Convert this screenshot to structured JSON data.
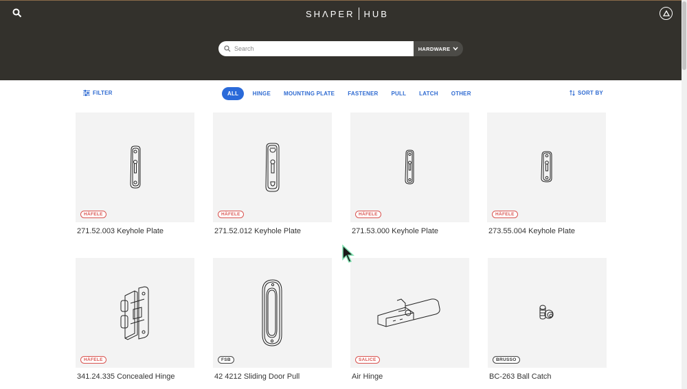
{
  "header": {
    "logo_left": "SHΛPER",
    "logo_right": "HUB",
    "search": {
      "placeholder": "Search"
    },
    "category_select": "HARDWARE"
  },
  "toolbar": {
    "filter_label": "FILTER",
    "sort_label": "SORT BY",
    "categories": [
      {
        "label": "ALL",
        "active": true
      },
      {
        "label": "HINGE",
        "active": false
      },
      {
        "label": "MOUNTING PLATE",
        "active": false
      },
      {
        "label": "FASTENER",
        "active": false
      },
      {
        "label": "PULL",
        "active": false
      },
      {
        "label": "LATCH",
        "active": false
      },
      {
        "label": "OTHER",
        "active": false
      }
    ]
  },
  "products": [
    {
      "brand": "HÄFELE",
      "brand_color": "red",
      "title": "271.52.003 Keyhole Plate",
      "icon": "keyhole-plate-icon"
    },
    {
      "brand": "HÄFELE",
      "brand_color": "red",
      "title": "271.52.012 Keyhole Plate",
      "icon": "keyhole-plate-icon"
    },
    {
      "brand": "HÄFELE",
      "brand_color": "red",
      "title": "271.53.000 Keyhole Plate",
      "icon": "keyhole-plate-icon"
    },
    {
      "brand": "HÄFELE",
      "brand_color": "red",
      "title": "273.55.004 Keyhole Plate",
      "icon": "keyhole-plate-icon"
    },
    {
      "brand": "HÄFELE",
      "brand_color": "red",
      "title": "341.24.335 Concealed Hinge",
      "icon": "concealed-hinge-icon"
    },
    {
      "brand": "FSB",
      "brand_color": "dark",
      "title": "42 4212 Sliding Door Pull",
      "icon": "door-pull-icon"
    },
    {
      "brand": "SALICE",
      "brand_color": "red",
      "title": "Air Hinge",
      "icon": "air-hinge-icon"
    },
    {
      "brand": "BRUSSO",
      "brand_color": "dark",
      "title": "BC-263 Ball Catch",
      "icon": "ball-catch-icon"
    }
  ],
  "colors": {
    "header_bg": "#33312c",
    "accent": "#2a6ad9",
    "brand_red": "#d9534f"
  }
}
